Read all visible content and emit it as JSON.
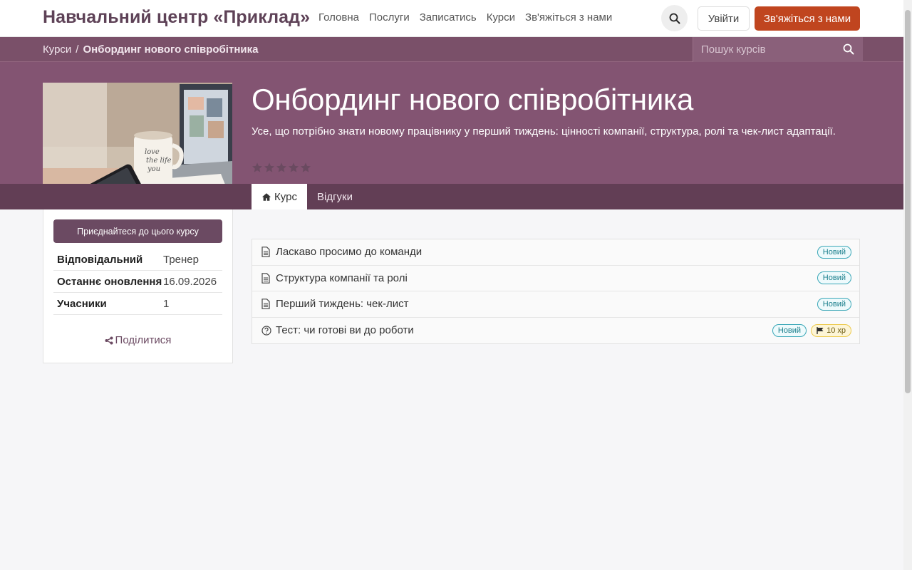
{
  "header": {
    "brand": "Навчальний центр «Приклад»",
    "menu": [
      "Головна",
      "Послуги",
      "Записатись",
      "Курси",
      "Зв'яжіться з нами"
    ],
    "login_label": "Увійти",
    "contact_label": "Зв'яжіться з нами"
  },
  "breadcrumb": {
    "parent": "Курси",
    "separator": "/",
    "current": "Онбординг нового співробітника"
  },
  "course_search": {
    "placeholder": "Пошук курсів"
  },
  "course": {
    "title": "Онбординг нового співробітника",
    "description": "Усе, що потрібно знати новому працівнику у перший тиждень: цінності компанії, структура, ролі та чек-лист адаптації.",
    "rating_stars": 5,
    "rating_filled": 0
  },
  "tabs": {
    "course": "Курс",
    "reviews": "Відгуки"
  },
  "sidebar": {
    "join_label": "Приєднайтеся до цього курсу",
    "rows": [
      {
        "label": "Відповідальний",
        "value": "Тренер"
      },
      {
        "label": "Останнє оновлення",
        "value": "16.09.2026"
      },
      {
        "label": "Учасники",
        "value": "1"
      }
    ],
    "share_label": "Поділитися"
  },
  "content": [
    {
      "name": "Ласкаво просимо до команди",
      "icon": "document-icon",
      "badge": "Новий"
    },
    {
      "name": "Структура компанії та ролі",
      "icon": "document-icon",
      "badge": "Новий"
    },
    {
      "name": "Перший тиждень: чек-лист",
      "icon": "document-icon",
      "badge": "Новий"
    },
    {
      "name": "Тест: чи готові ви до роботи",
      "icon": "question-circle-icon",
      "badge": "Новий",
      "xp": "10 xp"
    }
  ],
  "colors": {
    "brand": "#5e4257",
    "hero": "#835472",
    "tabstrip": "#623e55",
    "contact_button": "#c0451f",
    "join_button": "#6b4a62"
  }
}
